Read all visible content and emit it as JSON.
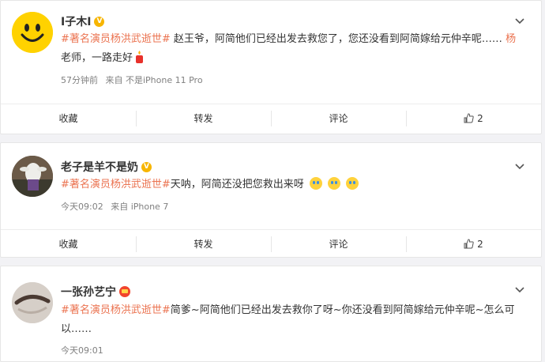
{
  "posts": [
    {
      "username": "I子木I",
      "text_parts": [
        {
          "kind": "topic",
          "text": "#著名演员杨洪武逝世#"
        },
        {
          "kind": "plain",
          "text": " 赵王爷，阿简他们已经出发去救您了，您还没看到阿简嫁给元仲辛呢…… "
        },
        {
          "kind": "topic",
          "text": "杨"
        },
        {
          "kind": "plain",
          "text": "老师，一路走好"
        }
      ],
      "time": "57分钟前",
      "source": "来自 不是iPhone 11 Pro",
      "actions": {
        "favorite": "收藏",
        "repost": "转发",
        "comment": "评论",
        "like_count": "2"
      }
    },
    {
      "username": "老子是羊不是奶",
      "text_parts": [
        {
          "kind": "topic",
          "text": "#著名演员杨洪武逝世#"
        },
        {
          "kind": "plain",
          "text": "天呐，阿简还没把您救出来呀"
        }
      ],
      "time": "今天09:02",
      "source": "来自 iPhone 7",
      "actions": {
        "favorite": "收藏",
        "repost": "转发",
        "comment": "评论",
        "like_count": "2"
      }
    },
    {
      "username": "一张孙艺宁",
      "text_parts": [
        {
          "kind": "topic",
          "text": "#著名演员杨洪武逝世#"
        },
        {
          "kind": "plain",
          "text": "简爹~阿简他们已经出发去救你了呀~你还没看到阿简嫁给元仲辛呢~怎么可以……"
        }
      ],
      "time": "今天09:01"
    }
  ],
  "icons": {
    "verified": "V",
    "like": "thumbs-up-icon",
    "more": "chevron-down-icon"
  },
  "colors": {
    "topic": "#eb7350",
    "badge": "#f7b500"
  }
}
